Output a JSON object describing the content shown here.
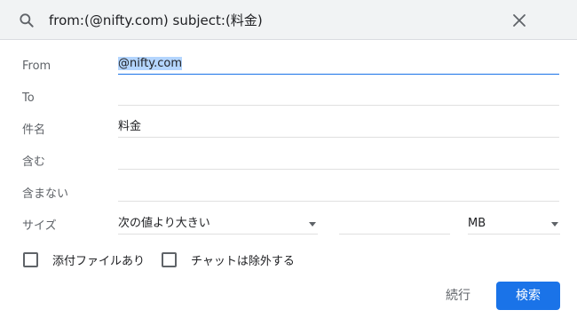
{
  "search": {
    "query": "from:(@nifty.com) subject:(料金)"
  },
  "form": {
    "from": {
      "label": "From",
      "value": "@nifty.com"
    },
    "to": {
      "label": "To",
      "value": ""
    },
    "subject": {
      "label": "件名",
      "value": "料金"
    },
    "has_words": {
      "label": "含む",
      "value": ""
    },
    "doesnt_have": {
      "label": "含まない",
      "value": ""
    },
    "size": {
      "label": "サイズ",
      "comparison": "次の値より大きい",
      "value": "",
      "unit": "MB"
    }
  },
  "options": {
    "has_attachment": {
      "label": "添付ファイルあり",
      "checked": false
    },
    "exclude_chats": {
      "label": "チャットは除外する",
      "checked": false
    }
  },
  "actions": {
    "continue_label": "続行",
    "search_label": "検索"
  },
  "colors": {
    "accent": "#1a73e8",
    "header_bg": "#f1f3f4",
    "selection": "#b4d5fe"
  },
  "icons": {
    "search": "search-icon",
    "close": "close-icon"
  }
}
